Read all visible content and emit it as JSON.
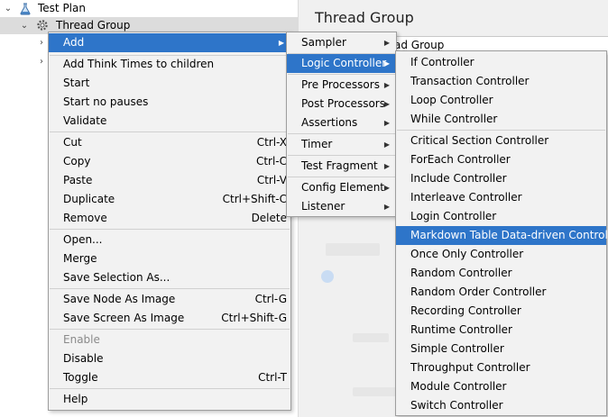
{
  "tree": {
    "test_plan": "Test Plan",
    "thread_group": "Thread Group"
  },
  "panel": {
    "title": "Thread Group",
    "name_value": "ad Group"
  },
  "context_menu": {
    "add": "Add",
    "add_think_times": "Add Think Times to children",
    "start": "Start",
    "start_no_pauses": "Start no pauses",
    "validate": "Validate",
    "cut": "Cut",
    "cut_short": "Ctrl-X",
    "copy": "Copy",
    "copy_short": "Ctrl-C",
    "paste": "Paste",
    "paste_short": "Ctrl-V",
    "duplicate": "Duplicate",
    "duplicate_short": "Ctrl+Shift-C",
    "remove": "Remove",
    "remove_short": "Delete",
    "open": "Open...",
    "merge": "Merge",
    "save_selection_as": "Save Selection As...",
    "save_node_as_image": "Save Node As Image",
    "save_node_short": "Ctrl-G",
    "save_screen_as_image": "Save Screen As Image",
    "save_screen_short": "Ctrl+Shift-G",
    "enable": "Enable",
    "disable": "Disable",
    "toggle": "Toggle",
    "toggle_short": "Ctrl-T",
    "help": "Help"
  },
  "add_menu": {
    "sampler": "Sampler",
    "logic_controller": "Logic Controller",
    "pre_processors": "Pre Processors",
    "post_processors": "Post Processors",
    "assertions": "Assertions",
    "timer": "Timer",
    "test_fragment": "Test Fragment",
    "config_element": "Config Element",
    "listener": "Listener"
  },
  "logic_controllers": {
    "if": "If Controller",
    "transaction": "Transaction Controller",
    "loop": "Loop Controller",
    "while": "While Controller",
    "critical_section": "Critical Section Controller",
    "foreach": "ForEach Controller",
    "include": "Include Controller",
    "interleave": "Interleave Controller",
    "login": "Login Controller",
    "markdown_table": "Markdown Table Data-driven Controller",
    "once_only": "Once Only Controller",
    "random": "Random Controller",
    "random_order": "Random Order Controller",
    "recording": "Recording Controller",
    "runtime": "Runtime Controller",
    "simple": "Simple Controller",
    "throughput": "Throughput Controller",
    "module": "Module Controller",
    "switch": "Switch Controller"
  },
  "icons": {
    "submenu": "chevron-right-icon",
    "expanded": "chevron-down-icon",
    "collapsed": "chevron-right-icon",
    "test_plan": "flask-icon",
    "thread_group": "gear-icon"
  },
  "colors": {
    "highlight": "#2e75c9",
    "menu_bg": "#f2f2f2"
  }
}
